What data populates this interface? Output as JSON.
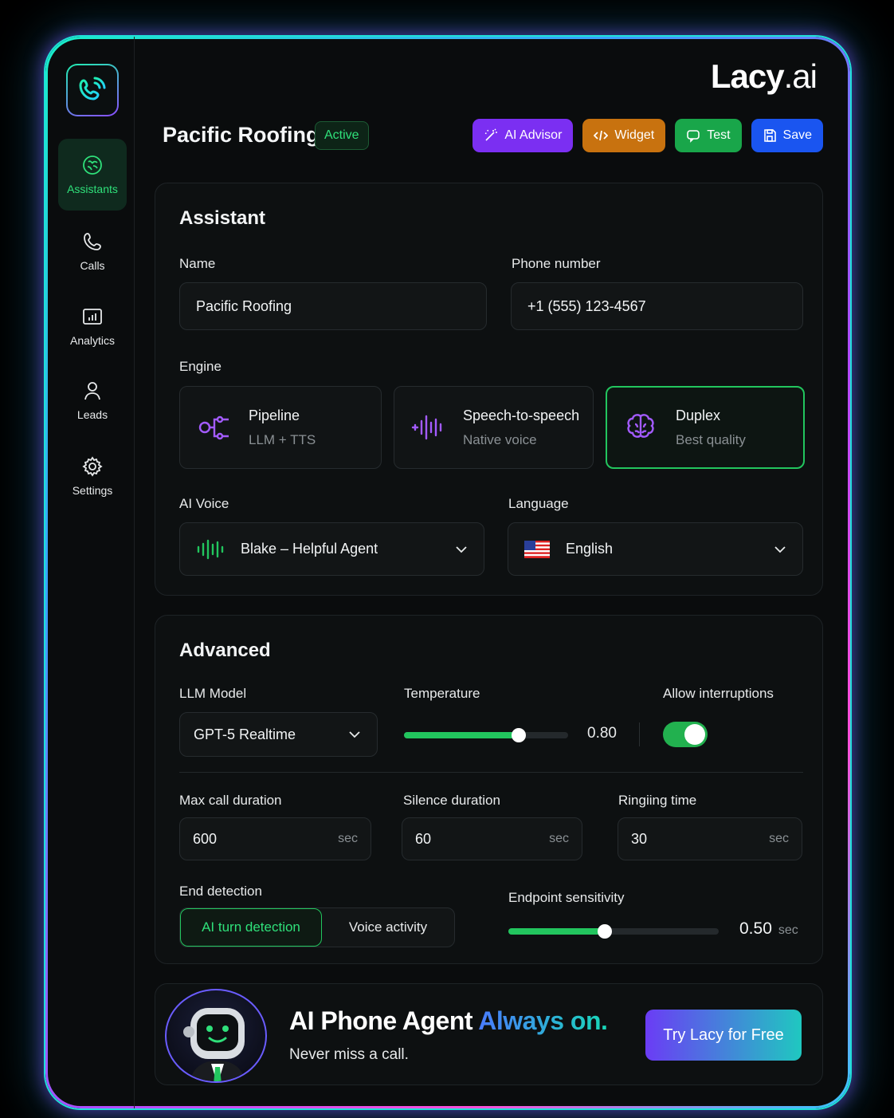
{
  "brand": {
    "name_main": "Lacy",
    "name_suffix": ".ai"
  },
  "sidebar": {
    "items": [
      {
        "label": "Assistants",
        "icon": "brain-icon",
        "active": true
      },
      {
        "label": "Calls",
        "icon": "phone-icon"
      },
      {
        "label": "Analytics",
        "icon": "chart-icon"
      },
      {
        "label": "Leads",
        "icon": "user-icon"
      },
      {
        "label": "Settings",
        "icon": "gear-icon"
      }
    ]
  },
  "header": {
    "title": "Pacific Roofing",
    "status": "Active",
    "buttons": {
      "advisor": "AI Advisor",
      "widget": "Widget",
      "test": "Test",
      "save": "Save"
    }
  },
  "assistant": {
    "section_title": "Assistant",
    "name_label": "Name",
    "name_value": "Pacific Roofing",
    "phone_label": "Phone number",
    "phone_value": "+1 (555) 123-4567",
    "engine_label": "Engine",
    "engines": [
      {
        "title": "Pipeline",
        "subtitle": "LLM + TTS"
      },
      {
        "title": "Speech-to-speech",
        "subtitle": "Native voice"
      },
      {
        "title": "Duplex",
        "subtitle": "Best quality",
        "selected": true
      }
    ],
    "voice_label": "AI Voice",
    "voice_value": "Blake – Helpful Agent",
    "language_label": "Language",
    "language_value": "English"
  },
  "advanced": {
    "section_title": "Advanced",
    "llm_label": "LLM Model",
    "llm_value": "GPT-5 Realtime",
    "temperature_label": "Temperature",
    "temperature_value": "0.80",
    "temperature_fraction": 0.7,
    "interruptions_label": "Allow interruptions",
    "interruptions_on": true,
    "max_call_label": "Max call duration",
    "max_call_value": "600",
    "silence_label": "Silence duration",
    "silence_value": "60",
    "ringing_label": "Ringiing time",
    "ringing_value": "30",
    "unit": "sec",
    "end_detection_label": "End detection",
    "end_detection_options": [
      "AI turn detection",
      "Voice activity"
    ],
    "endpoint_label": "Endpoint sensitivity",
    "endpoint_value": "0.50",
    "endpoint_fraction": 0.46
  },
  "banner": {
    "headline_main": "AI Phone Agent",
    "headline_accent": "Always on.",
    "subline": "Never miss a call.",
    "cta": "Try Lacy for Free"
  },
  "colors": {
    "accent_green": "#22c55e",
    "advisor": "#7b2ff2",
    "widget": "#c8720f",
    "test": "#19a64a",
    "save": "#1a55f0"
  }
}
